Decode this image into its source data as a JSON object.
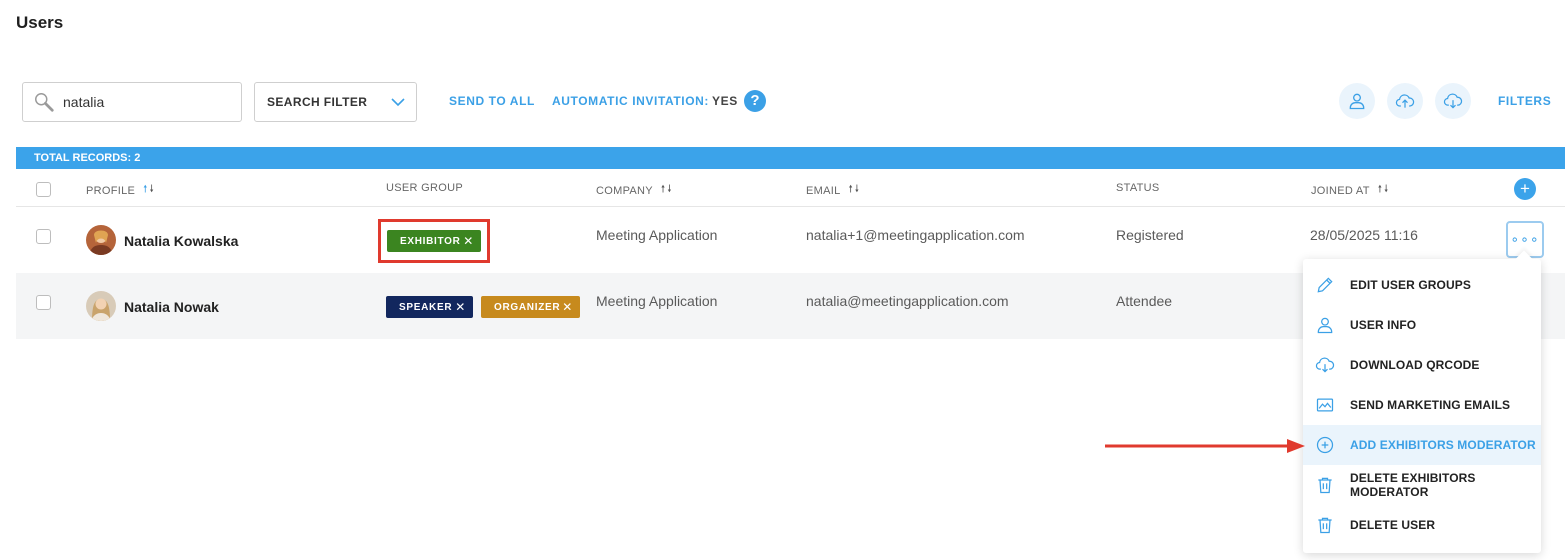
{
  "page": {
    "title": "Users"
  },
  "toolbar": {
    "search_value": "natalia",
    "filter_label": "SEARCH FILTER",
    "send_to_all": "SEND TO ALL",
    "automatic_invitation_label": "AUTOMATIC INVITATION:",
    "automatic_invitation_value": "YES",
    "help": "?",
    "filters": "FILTERS",
    "icons": [
      "user-icon",
      "cloud-upload-icon",
      "cloud-download-icon"
    ]
  },
  "table": {
    "total_records": "TOTAL RECORDS: 2",
    "columns": {
      "profile": "PROFILE",
      "user_group": "USER GROUP",
      "company": "COMPANY",
      "email": "EMAIL",
      "status": "STATUS",
      "joined_at": "JOINED AT"
    },
    "add_column": "+",
    "rows": [
      {
        "name": "Natalia Kowalska",
        "groups": [
          {
            "label": "EXHIBITOR",
            "color": "#3b8520"
          }
        ],
        "company": "Meeting Application",
        "email": "natalia+1@meetingapplication.com",
        "status": "Registered",
        "joined_at": "28/05/2025 11:16"
      },
      {
        "name": "Natalia Nowak",
        "groups": [
          {
            "label": "SPEAKER",
            "color": "#12275e"
          },
          {
            "label": "ORGANIZER",
            "color": "#c78a1d"
          }
        ],
        "company": "Meeting Application",
        "email": "natalia@meetingapplication.com",
        "status": "Attendee",
        "joined_at": ""
      }
    ]
  },
  "row_menu": {
    "more": "∘∘∘",
    "items": [
      {
        "label": "EDIT USER GROUPS",
        "icon": "pencil-icon"
      },
      {
        "label": "USER INFO",
        "icon": "user-icon"
      },
      {
        "label": "DOWNLOAD QRCODE",
        "icon": "cloud-download-icon"
      },
      {
        "label": "SEND MARKETING EMAILS",
        "icon": "image-icon"
      },
      {
        "label": "ADD EXHIBITORS MODERATOR",
        "icon": "plus-circle-icon",
        "active": true
      },
      {
        "label": "DELETE EXHIBITORS MODERATOR",
        "icon": "trash-icon"
      },
      {
        "label": "DELETE USER",
        "icon": "trash-icon"
      }
    ]
  },
  "colors": {
    "accent": "#3ba0e6",
    "header_bar": "#3ba3ea",
    "highlight": "#e03a2e"
  }
}
